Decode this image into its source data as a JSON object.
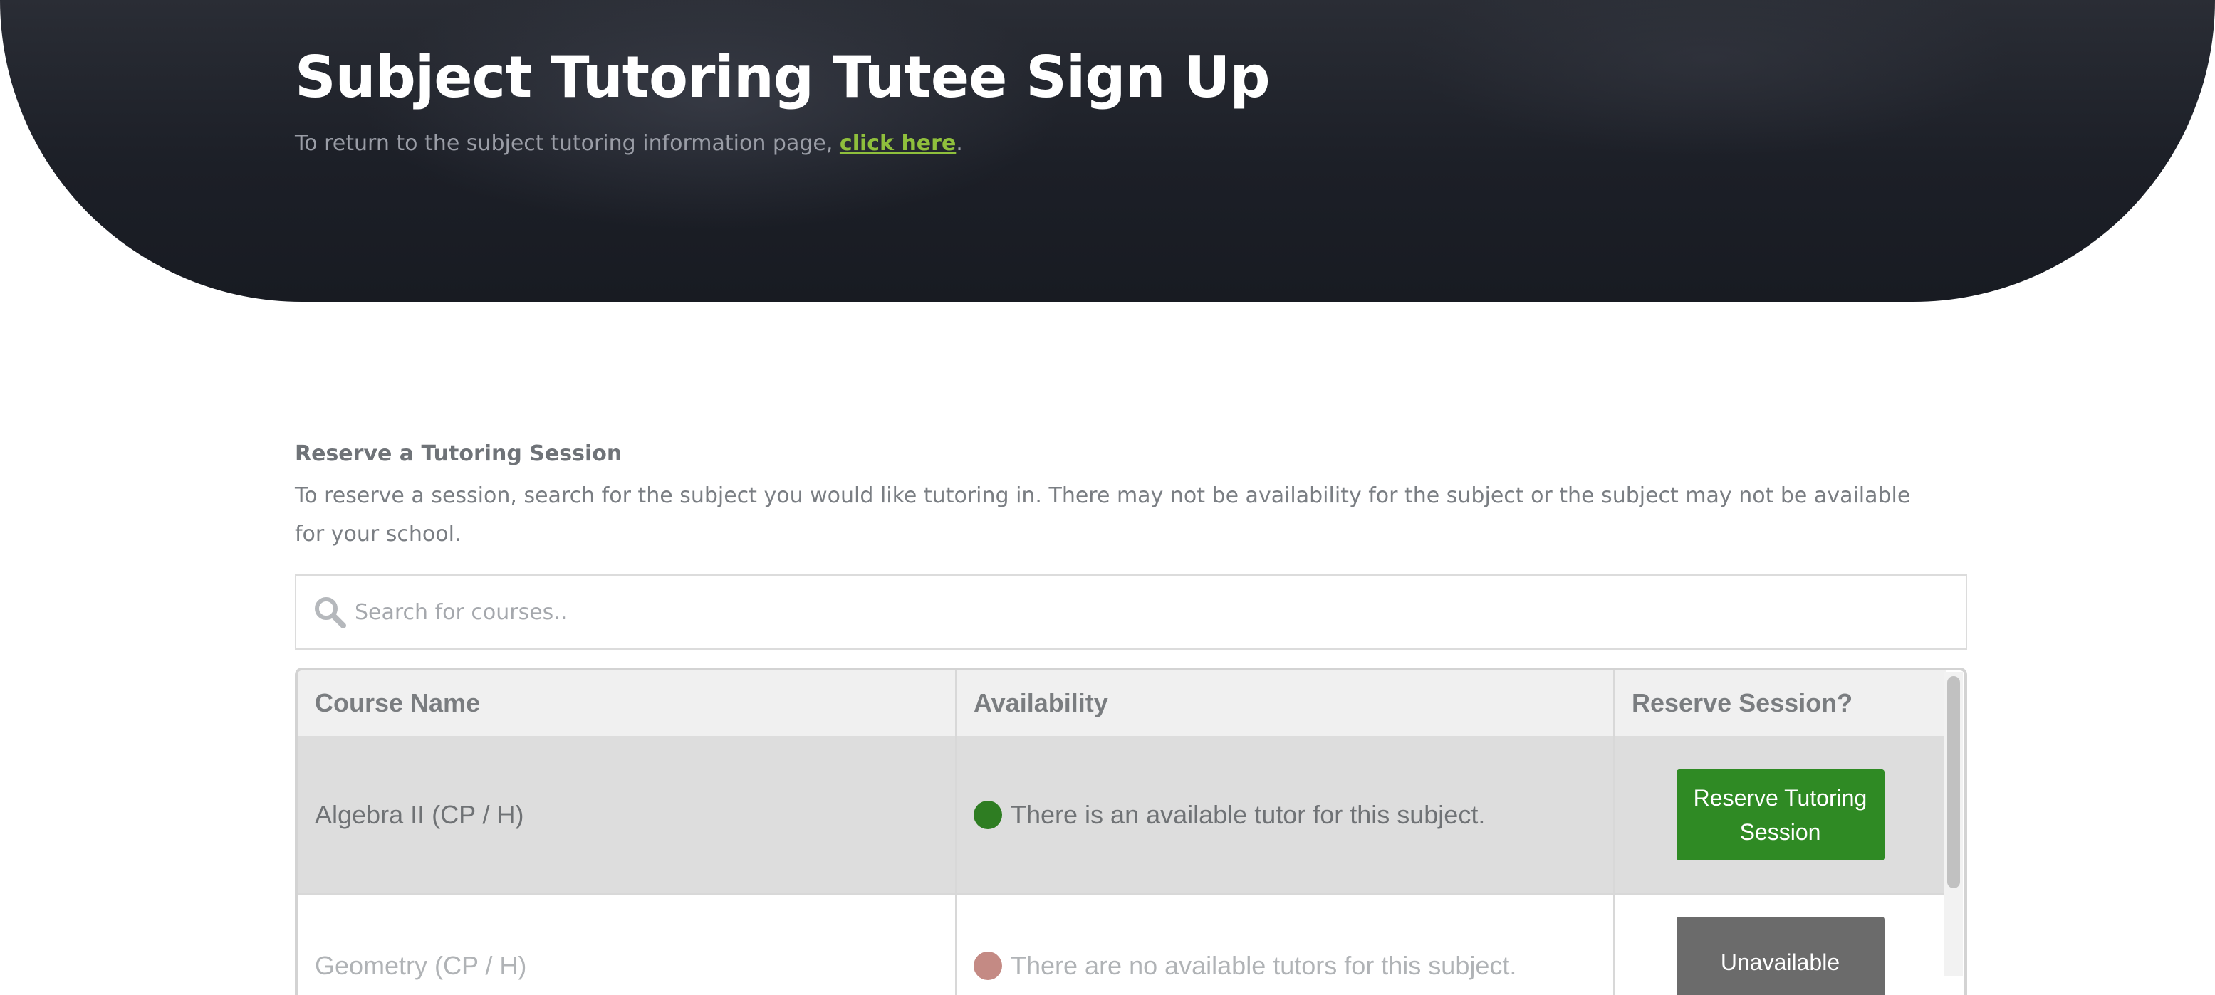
{
  "header": {
    "title": "Subject Tutoring Tutee Sign Up",
    "subtitle_prefix": "To return to the subject tutoring information page, ",
    "subtitle_link": "click here",
    "subtitle_suffix": "."
  },
  "reserve": {
    "heading": "Reserve a Tutoring Session",
    "description": "To reserve a session, search for the subject you would like tutoring in. There may not be availability for the subject or the subject may not be available for your school."
  },
  "search": {
    "placeholder": "Search for courses..",
    "value": ""
  },
  "table": {
    "columns": [
      "Course Name",
      "Availability",
      "Reserve Session?"
    ],
    "rows": [
      {
        "course": "Algebra II (CP / H)",
        "availability": "There is an available tutor for this subject.",
        "status_color": "#2e7d22",
        "action": "Reserve Tutoring Session"
      },
      {
        "course": "Geometry (CP / H)",
        "availability": "There are no available tutors for this subject.",
        "status_color": "#c48a84",
        "action": "Unavailable"
      }
    ]
  },
  "colors": {
    "accent_link": "#8fbf3c",
    "reserve_button": "#2f8a24",
    "unavailable_button": "#6b6b6b",
    "hero_background": "#1c1f27"
  }
}
